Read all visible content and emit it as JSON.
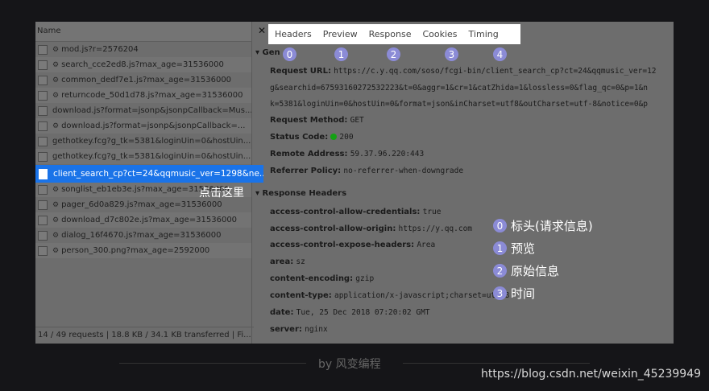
{
  "list": {
    "column_header": "Name",
    "rows": [
      {
        "name": "mod.js?r=2576204",
        "gear": true
      },
      {
        "name": "search_cce2ed8.js?max_age=31536000",
        "gear": true
      },
      {
        "name": "common_dedf7e1.js?max_age=31536000",
        "gear": true
      },
      {
        "name": "returncode_50d1d78.js?max_age=31536000",
        "gear": true
      },
      {
        "name": "download.js?format=jsonp&jsonpCallback=Mus...",
        "gear": false
      },
      {
        "name": "download.js?format=jsonp&jsonpCallback=...",
        "gear": true
      },
      {
        "name": "gethotkey.fcg?g_tk=5381&loginUin=0&hostUin...",
        "gear": false
      },
      {
        "name": "gethotkey.fcg?g_tk=5381&loginUin=0&hostUin...",
        "gear": false
      },
      {
        "name": "songlist_eb1eb3e.js?max_age=31536000",
        "gear": true
      },
      {
        "name": "pager_6d0a829.js?max_age=31536000",
        "gear": true
      },
      {
        "name": "download_d7c802e.js?max_age=31536000",
        "gear": true
      },
      {
        "name": "dialog_16f4670.js?max_age=31536000",
        "gear": true
      },
      {
        "name": "person_300.png?max_age=2592000",
        "gear": true
      }
    ],
    "selected_row": "client_search_cp?ct=24&qqmusic_ver=1298&ne...",
    "footer": "14 / 49 requests  |  18.8 KB / 34.1 KB transferred  |  Fi..."
  },
  "click_label": "点击这里",
  "tabs": [
    "Headers",
    "Preview",
    "Response",
    "Cookies",
    "Timing"
  ],
  "badges": [
    "0",
    "1",
    "2",
    "3",
    "4"
  ],
  "general": {
    "title": "Gen",
    "request_url_label": "Request URL:",
    "request_url_1": "https://c.y.qq.com/soso/fcgi-bin/client_search_cp?ct=24&qqmusic_ver=12",
    "request_url_2": "g&searchid=67593160272532223&t=0&aggr=1&cr=1&catZhida=1&lossless=0&flag_qc=0&p=1&n",
    "request_url_3": "k=5381&loginUin=0&hostUin=0&format=json&inCharset=utf8&outCharset=utf-8&notice=0&p",
    "method_label": "Request Method:",
    "method": "GET",
    "status_label": "Status Code:",
    "status": "200",
    "remote_label": "Remote Address:",
    "remote": "59.37.96.220:443",
    "referrer_label": "Referrer Policy:",
    "referrer": "no-referrer-when-downgrade"
  },
  "response_headers": {
    "title": "Response Headers",
    "items": [
      {
        "k": "access-control-allow-credentials:",
        "v": "true"
      },
      {
        "k": "access-control-allow-origin:",
        "v": "https://y.qq.com"
      },
      {
        "k": "access-control-expose-headers:",
        "v": "Area"
      },
      {
        "k": "area:",
        "v": "sz"
      },
      {
        "k": "content-encoding:",
        "v": "gzip"
      },
      {
        "k": "content-type:",
        "v": "application/x-javascript;charset=utf-8"
      },
      {
        "k": "date:",
        "v": "Tue, 25 Dec 2018 07:20:02 GMT"
      },
      {
        "k": "server:",
        "v": "nginx"
      }
    ]
  },
  "legend": [
    {
      "n": "0",
      "text": "标头(请求信息)"
    },
    {
      "n": "1",
      "text": "预览"
    },
    {
      "n": "2",
      "text": "原始信息"
    },
    {
      "n": "3",
      "text": "时间"
    }
  ],
  "byline": "by 风变编程",
  "watermark": "https://blog.csdn.net/weixin_45239949",
  "colors": {
    "selection": "#1a73e8",
    "badge": "#8b8bd6",
    "status_ok": "#13a113"
  }
}
